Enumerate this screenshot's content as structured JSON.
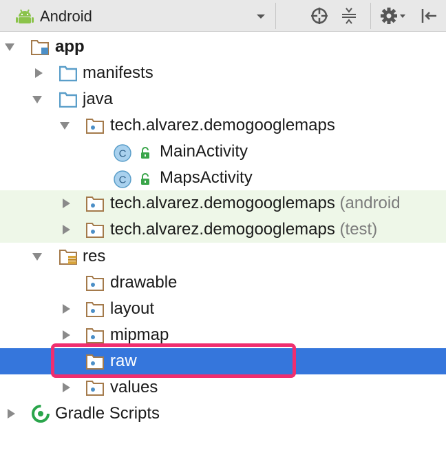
{
  "toolbar": {
    "view_mode": "Android",
    "icons": [
      "android-icon",
      "dropdown-caret-icon",
      "locate-icon",
      "collapse-all-icon",
      "gear-icon",
      "hide-panel-icon"
    ]
  },
  "tree": {
    "app": "app",
    "manifests": "manifests",
    "java": "java",
    "pkg_main": "tech.alvarez.demogooglemaps",
    "main_activity": "MainActivity",
    "maps_activity": "MapsActivity",
    "pkg_android": "tech.alvarez.demogooglemaps",
    "pkg_android_suffix": "(android",
    "pkg_test": "tech.alvarez.demogooglemaps",
    "pkg_test_suffix": "(test)",
    "res": "res",
    "drawable": "drawable",
    "layout": "layout",
    "mipmap": "mipmap",
    "raw": "raw",
    "values": "values",
    "gradle": "Gradle Scripts",
    "class_letter": "C"
  },
  "colors": {
    "selection": "#3576dc",
    "test_source_bg": "#eef7e8",
    "highlight": "#ef2e6f",
    "folder_brown": "#a47a4b",
    "folder_blue": "#5a9ec9"
  }
}
